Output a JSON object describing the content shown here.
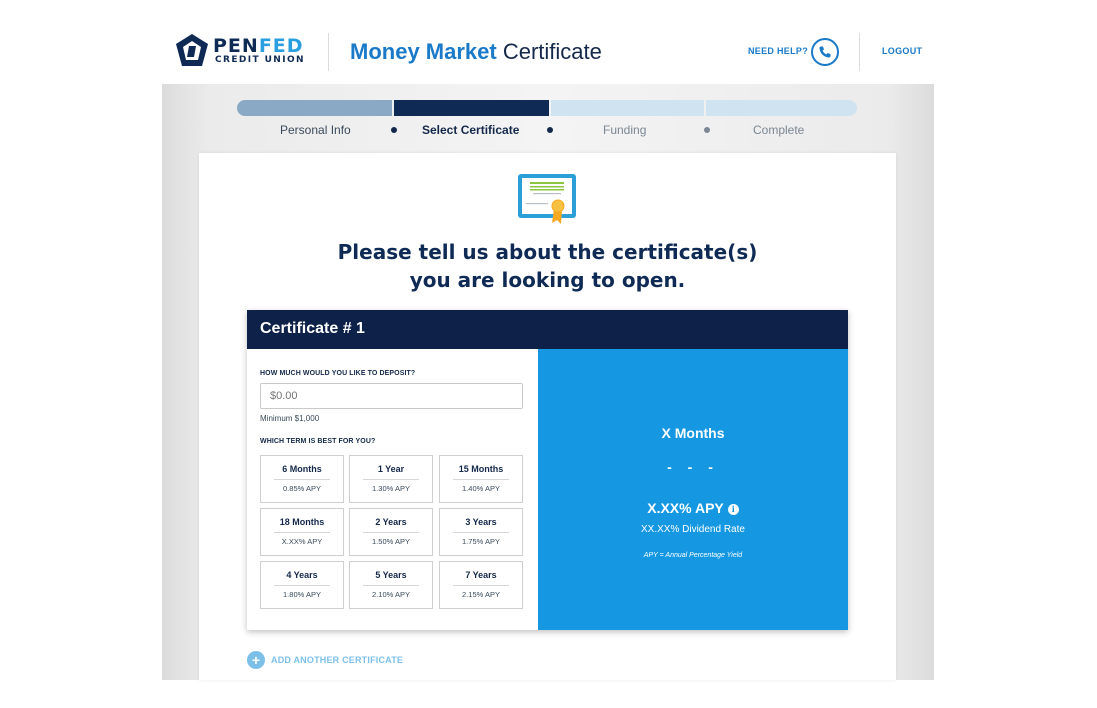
{
  "header": {
    "logo_main_a": "PEN",
    "logo_main_b": "FED",
    "logo_sub": "CREDIT UNION",
    "title_bold": "Money Market",
    "title_rest": " Certificate",
    "need_help": "NEED HELP?",
    "logout": "LOGOUT"
  },
  "progress": {
    "steps": [
      {
        "label": "Personal Info",
        "state": "complete"
      },
      {
        "label": "Select Certificate",
        "state": "active"
      },
      {
        "label": "Funding",
        "state": "upcoming"
      },
      {
        "label": "Complete",
        "state": "upcoming"
      }
    ]
  },
  "main": {
    "headline_line1": "Please tell us about the certificate(s)",
    "headline_line2": "you are looking to open."
  },
  "certificate": {
    "title": "Certificate # 1",
    "deposit_label": "HOW MUCH WOULD YOU LIKE TO DEPOSIT?",
    "deposit_placeholder": "$0.00",
    "minimum": "Minimum $1,000",
    "term_label": "WHICH TERM IS BEST FOR YOU?",
    "terms": [
      {
        "name": "6 Months",
        "apy": "0.85% APY"
      },
      {
        "name": "1 Year",
        "apy": "1.30% APY"
      },
      {
        "name": "15 Months",
        "apy": "1.40% APY"
      },
      {
        "name": "18 Months",
        "apy": "X.XX% APY"
      },
      {
        "name": "2 Years",
        "apy": "1.50% APY"
      },
      {
        "name": "3 Years",
        "apy": "1.75% APY"
      },
      {
        "name": "4 Years",
        "apy": "1.80% APY"
      },
      {
        "name": "5 Years",
        "apy": "2.10% APY"
      },
      {
        "name": "7 Years",
        "apy": "2.15% APY"
      }
    ],
    "summary": {
      "months": "X Months",
      "dashes": "- - -",
      "apy": "X.XX% APY",
      "info_glyph": "i",
      "dividend": "XX.XX% Dividend Rate",
      "note": "APY = Annual Percentage Yield"
    }
  },
  "add_certificate": {
    "icon": "+",
    "label": "ADD ANOTHER CERTIFICATE"
  },
  "colors": {
    "navy": "#0e2148",
    "brand_blue": "#1a79c8",
    "summary_blue": "#1597e2",
    "progress_done": "#8aa9c5",
    "progress_todo": "#cfe3f1"
  }
}
